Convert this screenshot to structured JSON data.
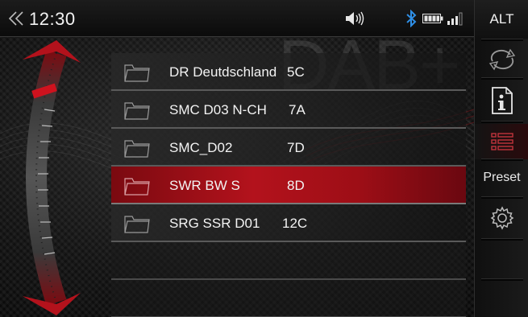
{
  "status": {
    "time": "12:30",
    "icons": [
      "back-chevron-icon",
      "volume-icon",
      "bluetooth-icon",
      "battery-icon",
      "signal-strength-icon"
    ]
  },
  "watermark": "DAB+",
  "stations": [
    {
      "name": "DR Deutdschland",
      "channel": "5C",
      "active": false
    },
    {
      "name": "SMC D03 N-CH",
      "channel": "7A",
      "active": false
    },
    {
      "name": "SMC_D02",
      "channel": "7D",
      "active": false
    },
    {
      "name": "SWR BW S",
      "channel": "8D",
      "active": true
    },
    {
      "name": "SRG SSR D01",
      "channel": "12C",
      "active": false
    }
  ],
  "sidebar": {
    "alt_label": "ALT",
    "preset_label": "Preset",
    "icons": [
      "repeat-icon",
      "info-document-icon",
      "list-view-icon",
      "settings-gear-icon"
    ]
  },
  "colors": {
    "accent": "#b3121c",
    "text": "#f3f3f3"
  }
}
